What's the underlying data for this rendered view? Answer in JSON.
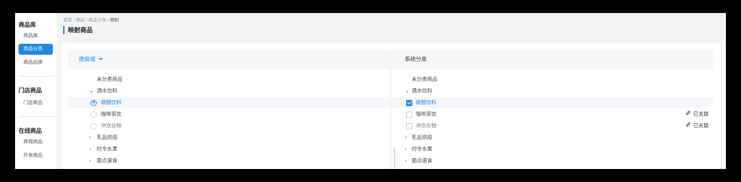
{
  "sidebar": {
    "groups": [
      {
        "title": "商品库",
        "items": [
          "商品库",
          "商品分类",
          "商品品牌"
        ],
        "active": 1
      },
      {
        "title": "门店商品",
        "items": [
          "门店商品"
        ],
        "active": -1
      },
      {
        "title": "在线商品",
        "items": [
          "商城商品",
          "外卖商品"
        ],
        "active": -1
      }
    ]
  },
  "breadcrumb": {
    "items": [
      "首页",
      "商品",
      "商品分类"
    ],
    "current": "映射",
    "separator": "/"
  },
  "page_title": "映射商品",
  "left_panel": {
    "header": "德商城",
    "rows": [
      "未分类商品",
      "酒水饮料",
      "碳酸饮料",
      "咖啡茶饮",
      "冲饮谷物",
      "乳品烘焙",
      "时令水果",
      "面点速食"
    ]
  },
  "right_panel": {
    "header": "系统分类",
    "rows": [
      "未分类商品",
      "酒水饮料",
      "碳酸饮料",
      "咖啡茶饮",
      "冲饮谷物",
      "乳品烘焙",
      "时令水果",
      "面点速食"
    ],
    "linked_label": "已关联"
  },
  "colors": {
    "accent": "#1e88e5"
  }
}
